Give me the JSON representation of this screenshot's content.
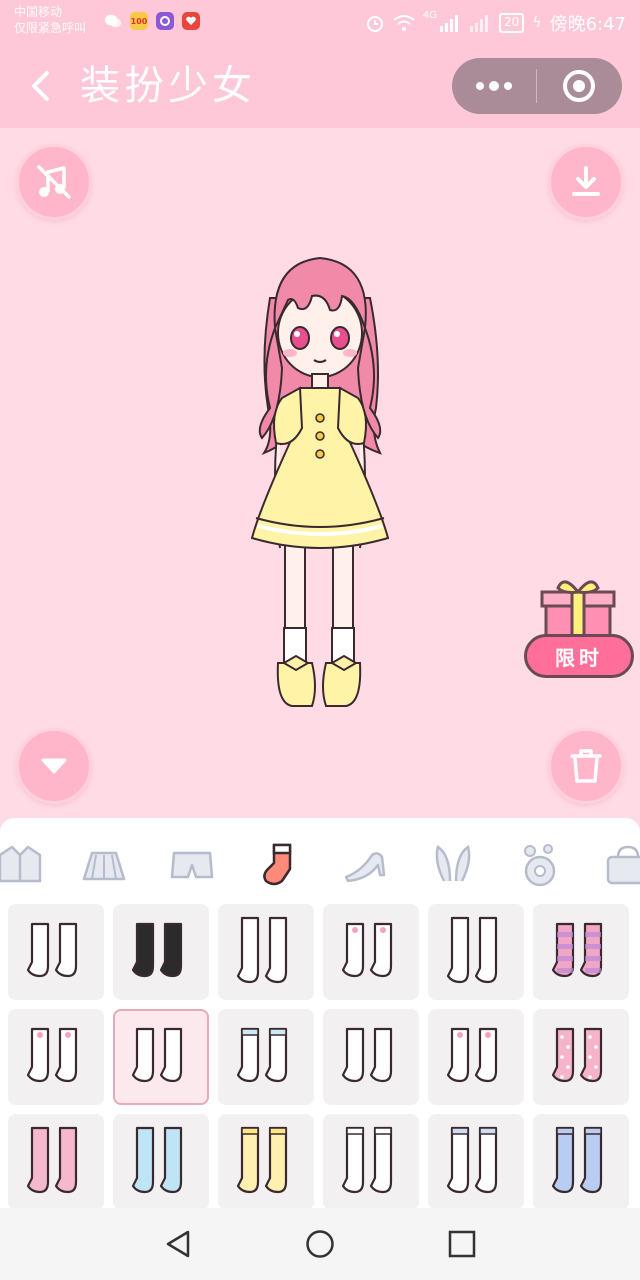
{
  "status_bar": {
    "carrier_line1": "中国移动",
    "carrier_line2": "仅限紧急呼叫",
    "app_badge_1": "100",
    "battery": "20",
    "time": "傍晚6:47",
    "network": "4G"
  },
  "nav": {
    "title": "装扮少女",
    "back_icon": "chevron-left-icon",
    "more_icon": "more-dots-icon",
    "close_icon": "target-close-icon"
  },
  "stage": {
    "music_icon": "music-off-icon",
    "download_icon": "download-icon",
    "collapse_icon": "chevron-down-icon",
    "trash_icon": "trash-icon",
    "gift_label": "限时"
  },
  "categories": [
    {
      "name": "jacket",
      "icon": "jacket-icon"
    },
    {
      "name": "skirt",
      "icon": "skirt-icon"
    },
    {
      "name": "shorts",
      "icon": "shorts-icon"
    },
    {
      "name": "socks",
      "icon": "sock-icon",
      "active": true
    },
    {
      "name": "shoes",
      "icon": "high-heel-icon"
    },
    {
      "name": "headwear",
      "icon": "bunny-ears-icon"
    },
    {
      "name": "accessory",
      "icon": "flower-icon"
    },
    {
      "name": "bag",
      "icon": "bag-icon"
    }
  ],
  "items": [
    {
      "type": "white-knee-socks",
      "color": "#ffffff"
    },
    {
      "type": "black-knee-socks",
      "color": "#2b2b2b"
    },
    {
      "type": "white-tights",
      "color": "#ffffff"
    },
    {
      "type": "ankle-socks-bows",
      "color": "#ffffff"
    },
    {
      "type": "white-tights-2",
      "color": "#ffffff"
    },
    {
      "type": "striped-socks",
      "color": "#f2a6c6"
    },
    {
      "type": "ruffle-socks",
      "color": "#ffffff"
    },
    {
      "type": "plain-knee-socks",
      "color": "#ffffff",
      "selected": true
    },
    {
      "type": "blue-trim-socks",
      "color": "#ffffff"
    },
    {
      "type": "long-white-socks",
      "color": "#ffffff"
    },
    {
      "type": "pink-bow-socks",
      "color": "#ffffff"
    },
    {
      "type": "polka-dot-socks",
      "color": "#f6b3cc"
    },
    {
      "type": "pink-stockings",
      "color": "#f6b8cc"
    },
    {
      "type": "blue-stockings",
      "color": "#bfe4f6"
    },
    {
      "type": "yellow-stockings",
      "color": "#fdf0b0"
    },
    {
      "type": "white-lace-stockings",
      "color": "#ffffff"
    },
    {
      "type": "white-blue-stockings",
      "color": "#ffffff"
    },
    {
      "type": "blue-ruffle-stockings",
      "color": "#b9cdf2"
    }
  ],
  "colors": {
    "header_pink": "#ffc8d9",
    "stage_pink": "#ffdbe5",
    "button_pink": "#ffb6cb",
    "accent": "#ff6f9a"
  }
}
